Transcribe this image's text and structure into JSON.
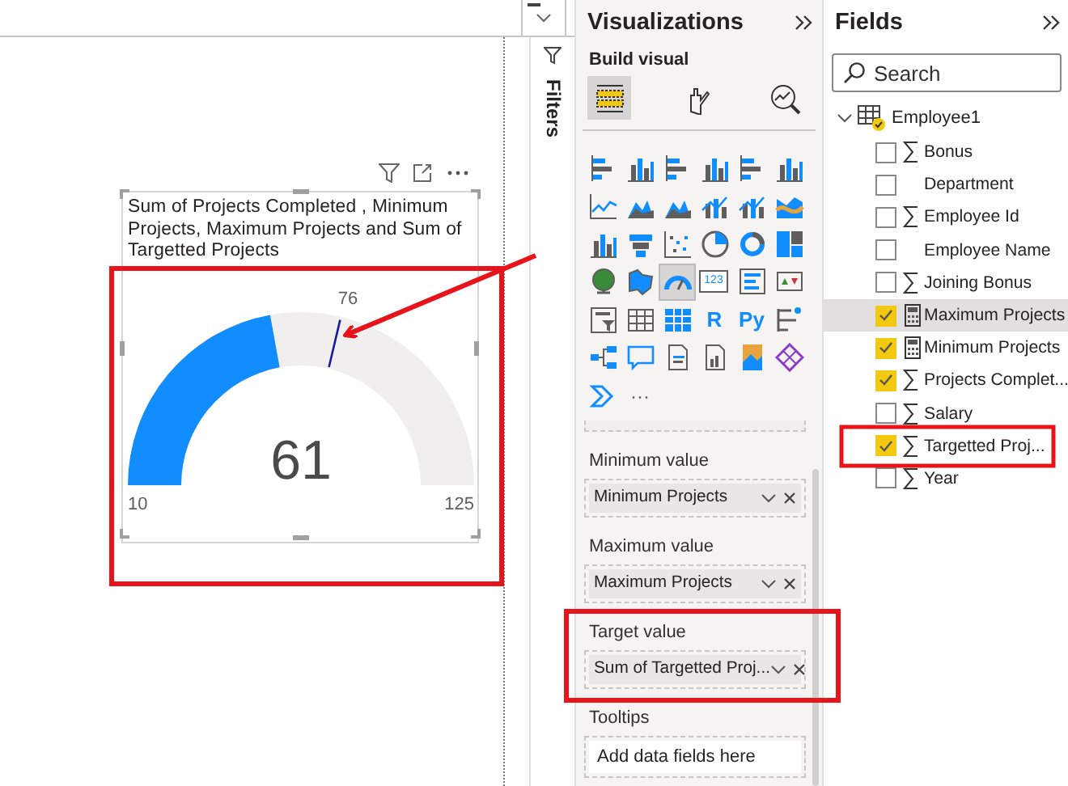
{
  "visual": {
    "title": "Sum of Projects Completed , Minimum Projects, Maximum Projects and Sum of Targetted Projects",
    "gauge": {
      "value": "61",
      "min": "10",
      "max": "125",
      "level": 0.443,
      "target": {
        "label": "76",
        "level": 0.574
      }
    }
  },
  "filters": {
    "title": "Filters"
  },
  "visualizations": {
    "title": "Visualizations",
    "subtitle": "Build visual",
    "modes": [
      {
        "kind": "fields",
        "selected": true
      },
      {
        "kind": "format",
        "selected": false
      },
      {
        "kind": "analytics",
        "selected": false
      }
    ],
    "types": [
      {
        "kind": "bar",
        "selected": false
      },
      {
        "kind": "column",
        "selected": false
      },
      {
        "kind": "bar",
        "selected": false
      },
      {
        "kind": "column",
        "selected": false
      },
      {
        "kind": "bar",
        "selected": false
      },
      {
        "kind": "column",
        "selected": false
      },
      {
        "kind": "line",
        "selected": false
      },
      {
        "kind": "area",
        "selected": false
      },
      {
        "kind": "area",
        "selected": false
      },
      {
        "kind": "combo",
        "selected": false
      },
      {
        "kind": "combo",
        "selected": false
      },
      {
        "kind": "ribbon",
        "selected": false
      },
      {
        "kind": "column",
        "selected": false
      },
      {
        "kind": "funnel",
        "selected": false
      },
      {
        "kind": "scatter",
        "selected": false
      },
      {
        "kind": "pie",
        "selected": false
      },
      {
        "kind": "donut",
        "selected": false
      },
      {
        "kind": "treemap",
        "selected": false
      },
      {
        "kind": "globe",
        "selected": false
      },
      {
        "kind": "map",
        "selected": false
      },
      {
        "kind": "gauge",
        "selected": true
      },
      {
        "kind": "card",
        "label": "123",
        "selected": false
      },
      {
        "kind": "list",
        "selected": false
      },
      {
        "kind": "kpi",
        "selected": false
      },
      {
        "kind": "slicer",
        "selected": false
      },
      {
        "kind": "table",
        "selected": false
      },
      {
        "kind": "matrix",
        "selected": false
      },
      {
        "kind": "text",
        "label": "R",
        "selected": false
      },
      {
        "kind": "text",
        "label": "Py",
        "selected": false
      },
      {
        "kind": "influencers",
        "selected": false
      },
      {
        "kind": "hierarchy",
        "selected": false
      },
      {
        "kind": "bubble",
        "selected": false
      },
      {
        "kind": "document",
        "selected": false
      },
      {
        "kind": "report",
        "selected": false
      },
      {
        "kind": "app",
        "selected": false
      },
      {
        "kind": "diamond",
        "selected": false
      },
      {
        "kind": "chevron",
        "selected": false
      },
      {
        "kind": "text",
        "label": "···",
        "selected": false
      }
    ],
    "wells": [
      {
        "label": "Minimum value",
        "field": "Minimum Projects"
      },
      {
        "label": "Maximum value",
        "field": "Maximum Projects"
      },
      {
        "label": "Target value",
        "field": "Sum of Targetted Proj..."
      },
      {
        "label": "Tooltips",
        "placeholder": "Add data fields here"
      }
    ]
  },
  "fields": {
    "title": "Fields",
    "search": {
      "placeholder": "Search"
    },
    "tree": [
      {
        "name": "Employee1",
        "expanded": true,
        "children": [
          {
            "name": "Bonus",
            "kind": "sum",
            "checked": false,
            "selected": false
          },
          {
            "name": "Department",
            "kind": "text",
            "checked": false,
            "selected": false
          },
          {
            "name": "Employee Id",
            "kind": "sum",
            "checked": false,
            "selected": false
          },
          {
            "name": "Employee Name",
            "kind": "text",
            "checked": false,
            "selected": false
          },
          {
            "name": "Joining Bonus",
            "kind": "sum",
            "checked": false,
            "selected": false
          },
          {
            "name": "Maximum Projects",
            "kind": "measure",
            "checked": true,
            "selected": true
          },
          {
            "name": "Minimum Projects",
            "kind": "measure",
            "checked": true,
            "selected": false
          },
          {
            "name": "Projects Complet...",
            "kind": "sum",
            "checked": true,
            "selected": false
          },
          {
            "name": "Salary",
            "kind": "sum",
            "checked": false,
            "selected": false
          },
          {
            "name": "Targetted Proj...",
            "kind": "sum",
            "checked": true,
            "selected": false
          },
          {
            "name": "Year",
            "kind": "sum",
            "checked": false,
            "selected": false
          }
        ]
      }
    ]
  }
}
